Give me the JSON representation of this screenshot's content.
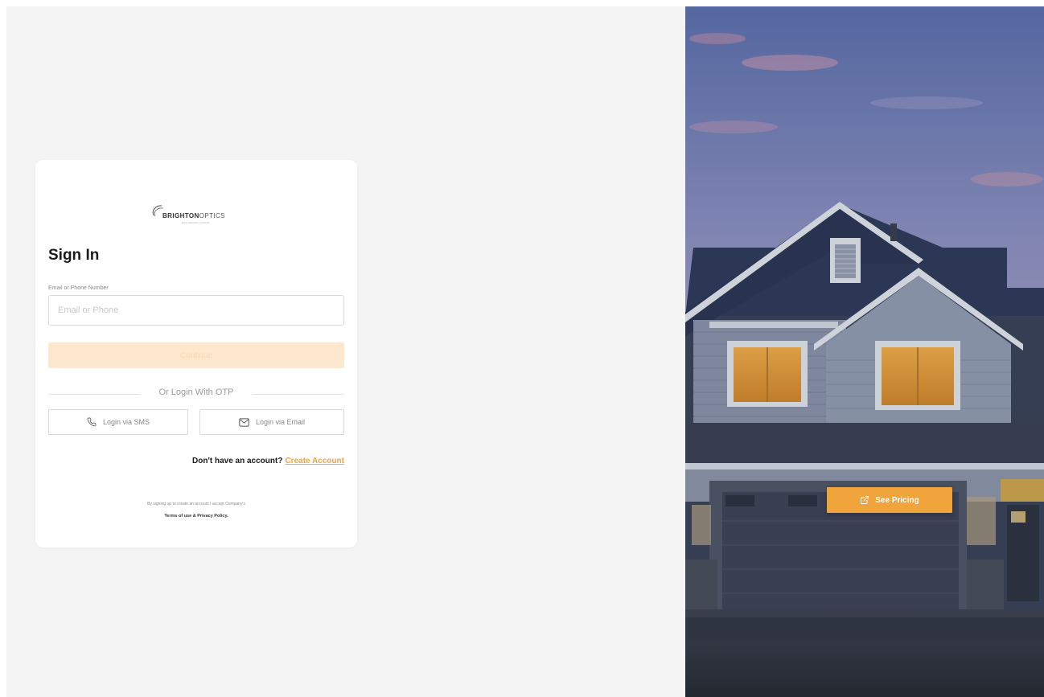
{
  "brand": {
    "name_bold": "BRIGHTON",
    "name_thin": "OPTICS",
    "tagline": "DELIVERING VISION"
  },
  "signin": {
    "title": "Sign In",
    "email_label": "Email or Phone Number",
    "email_placeholder": "Email or Phone",
    "email_value": "",
    "continue_label": "Continue",
    "otp_divider": "Or Login With OTP",
    "sms_button": "Login via SMS",
    "email_button": "Login via Email",
    "no_account_text": "Don't have an account?",
    "create_account_link": "Create Account",
    "legal_text": "By signing up to create an account I accept Company's",
    "legal_links": "Terms of use & Privacy Policy."
  },
  "hero": {
    "pricing_button": "See Pricing"
  },
  "colors": {
    "accent": "#f0a43c",
    "accent_disabled": "#fde8ce",
    "page_background": "#f4f4f4",
    "card_background": "#ffffff"
  },
  "icons": [
    "phone-icon",
    "mail-icon",
    "external-link-icon",
    "brand-logo-icon"
  ]
}
